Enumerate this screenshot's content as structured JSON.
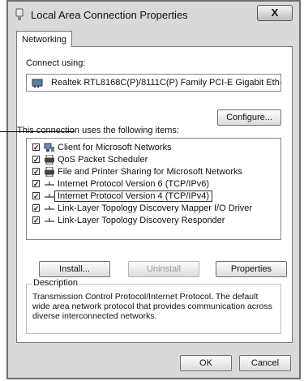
{
  "window": {
    "title": "Local Area Connection Properties",
    "close_label": "X"
  },
  "tab": {
    "label": "Networking"
  },
  "connect_using": {
    "label": "Connect using:",
    "adapter": "Realtek RTL8168C(P)/8111C(P) Family PCI-E Gigabit Eth·"
  },
  "configure_label": "Configure...",
  "items_label": "This connection uses the following items:",
  "items": [
    {
      "label": "Client for Microsoft Networks",
      "checked": true,
      "icon": "network-client-icon"
    },
    {
      "label": "QoS Packet Scheduler",
      "checked": true,
      "icon": "printer-icon"
    },
    {
      "label": "File and Printer Sharing for Microsoft Networks",
      "checked": true,
      "icon": "printer-icon"
    },
    {
      "label": "Internet Protocol Version 6 (TCP/IPv6)",
      "checked": true,
      "icon": "protocol-icon"
    },
    {
      "label": "Internet Protocol Version 4 (TCP/IPv4)",
      "checked": true,
      "icon": "protocol-icon",
      "selected": true
    },
    {
      "label": "Link-Layer Topology Discovery Mapper I/O Driver",
      "checked": true,
      "icon": "protocol-icon"
    },
    {
      "label": "Link-Layer Topology Discovery Responder",
      "checked": true,
      "icon": "protocol-icon"
    }
  ],
  "buttons": {
    "install": "Install...",
    "uninstall": "Uninstall",
    "properties": "Properties"
  },
  "description": {
    "legend": "Description",
    "text": "Transmission Control Protocol/Internet Protocol. The default wide area network protocol that provides communication across diverse interconnected networks."
  },
  "footer": {
    "ok": "OK",
    "cancel": "Cancel"
  }
}
